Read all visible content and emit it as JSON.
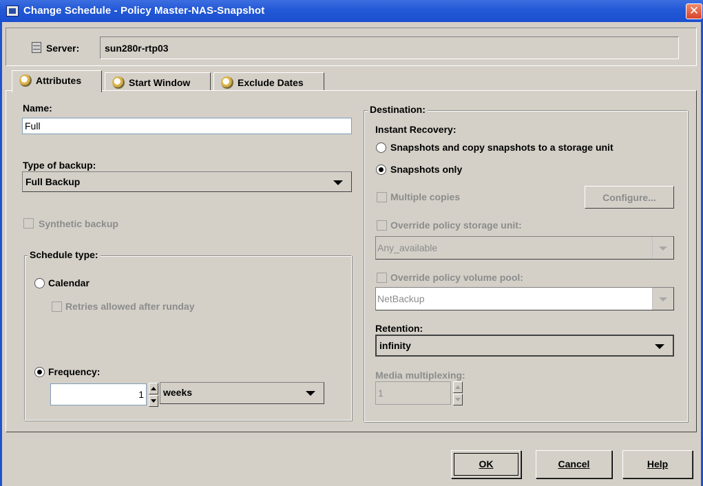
{
  "window": {
    "title": "Change Schedule - Policy Master-NAS-Snapshot",
    "close_glyph": "✕"
  },
  "server": {
    "label": "Server:",
    "value": "sun280r-rtp03"
  },
  "tabs": [
    {
      "label": "Attributes",
      "active": true
    },
    {
      "label": "Start Window",
      "active": false
    },
    {
      "label": "Exclude Dates",
      "active": false
    }
  ],
  "left": {
    "name_label": "Name:",
    "name_value": "Full",
    "backup_type_label": "Type of backup:",
    "backup_type_value": "Full Backup",
    "synthetic_label": "Synthetic backup",
    "schedule_type_legend": "Schedule type:",
    "calendar_label": "Calendar",
    "retries_label": "Retries allowed after runday",
    "frequency_label": "Frequency:",
    "frequency_value": "1",
    "frequency_unit": "weeks"
  },
  "right": {
    "destination_legend": "Destination:",
    "instant_recovery_label": "Instant Recovery:",
    "option_copy_label": "Snapshots and copy snapshots to a storage unit",
    "option_snapshots_only_label": "Snapshots only",
    "multiple_copies_label": "Multiple copies",
    "configure_label": "Configure...",
    "override_storage_label": "Override policy storage unit:",
    "storage_unit_value": "Any_available",
    "override_pool_label": "Override policy volume pool:",
    "volume_pool_value": "NetBackup",
    "retention_label": "Retention:",
    "retention_value": "infinity",
    "multiplexing_label": "Media multiplexing:",
    "multiplexing_value": "1"
  },
  "buttons": {
    "ok": "OK",
    "cancel": "Cancel",
    "help": "Help"
  }
}
